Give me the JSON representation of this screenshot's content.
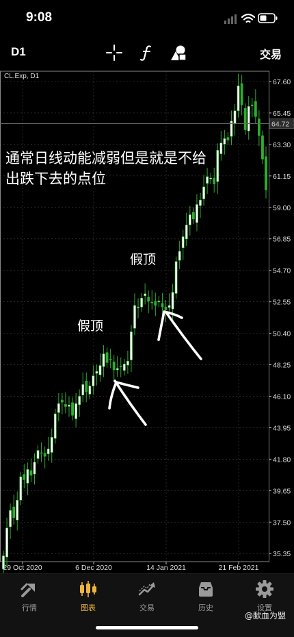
{
  "status": {
    "time": "9:08"
  },
  "toolbar": {
    "timeframe": "D1",
    "trade": "交易",
    "icons": [
      "crosshair-icon",
      "function-icon",
      "objects-icon"
    ]
  },
  "chart": {
    "symbol_label": "CL.Exp, D1",
    "current_price": "64.72",
    "annotation_main": "通常日线动能减弱但是就是不给出跌下去的点位",
    "annotation_fake_top": "假顶",
    "colors": {
      "bull": "#ffffff",
      "bear": "#2eae2e",
      "grid": "#3a3a3a",
      "axis_text": "#dddddd",
      "price_line": "#666666"
    }
  },
  "chart_data": {
    "type": "candlestick",
    "title": "CL.Exp, D1",
    "x_ticks": [
      "29 Oct 2020",
      "6 Dec 2020",
      "14 Jan 2021",
      "21 Feb 2021"
    ],
    "y_ticks": [
      "67.60",
      "65.45",
      "63.30",
      "61.15",
      "59.00",
      "56.85",
      "54.70",
      "52.55",
      "50.40",
      "48.25",
      "46.10",
      "43.95",
      "41.80",
      "39.65",
      "37.50",
      "35.35"
    ],
    "ylim": [
      34.8,
      68.3
    ],
    "current_price": 64.72,
    "grid": true,
    "closes": [
      35.2,
      37.1,
      38.3,
      37.8,
      39.0,
      40.6,
      40.4,
      41.1,
      40.7,
      41.6,
      42.4,
      42.2,
      42.0,
      42.5,
      43.3,
      44.9,
      45.6,
      45.7,
      45.4,
      45.5,
      44.8,
      45.6,
      46.1,
      46.9,
      46.4,
      46.8,
      47.5,
      47.8,
      48.2,
      49.0,
      48.4,
      48.6,
      47.9,
      48.0,
      48.1,
      48.3,
      48.5,
      50.5,
      52.3,
      52.2,
      52.8,
      53.1,
      52.6,
      52.5,
      52.3,
      52.6,
      52.2,
      52.0,
      52.3,
      53.2,
      55.3,
      56.0,
      57.0,
      57.8,
      58.5,
      58.2,
      59.2,
      59.5,
      60.4,
      61.1,
      61.0,
      60.6,
      62.9,
      63.4,
      63.7,
      63.6,
      64.9,
      65.6,
      67.3,
      66.0,
      64.3,
      65.9,
      66.0,
      65.2,
      63.9,
      62.3,
      60.2
    ]
  },
  "tabs": [
    {
      "label": "行情",
      "icon": "quotes-icon"
    },
    {
      "label": "图表",
      "icon": "candles-icon"
    },
    {
      "label": "交易",
      "icon": "trade-icon"
    },
    {
      "label": "历史",
      "icon": "history-icon"
    },
    {
      "label": "设置",
      "icon": "settings-icon"
    }
  ],
  "watermark": "@歃血为盟"
}
